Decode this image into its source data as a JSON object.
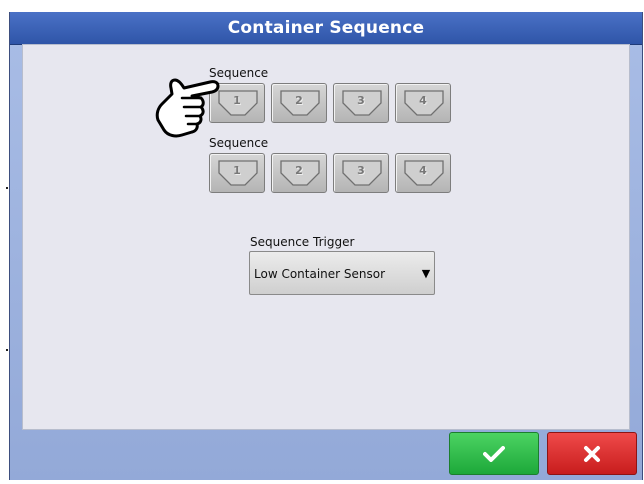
{
  "dialog": {
    "title": "Container Sequence"
  },
  "sequence_groups": [
    {
      "label": "Sequence",
      "buttons": [
        "1",
        "2",
        "3",
        "4"
      ]
    },
    {
      "label": "Sequence",
      "buttons": [
        "1",
        "2",
        "3",
        "4"
      ]
    }
  ],
  "trigger": {
    "label": "Sequence Trigger",
    "value": "Low Container Sensor"
  },
  "icons": {
    "ok": "checkmark-icon",
    "cancel": "x-icon",
    "pointer": "pointing-hand-icon",
    "dropdown": "triangle-down-icon"
  },
  "colors": {
    "title_bar": "#3a62b8",
    "ok_button": "#2fbd4b",
    "cancel_button": "#d92b2b",
    "panel": "#e7e7ef"
  }
}
